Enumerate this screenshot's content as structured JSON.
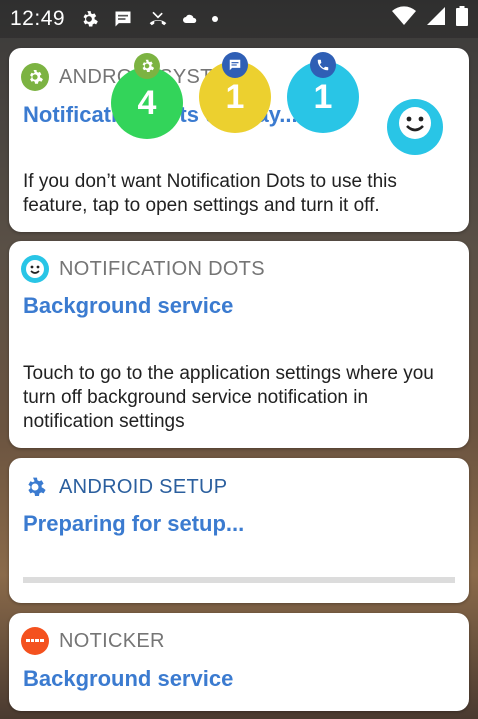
{
  "status_bar": {
    "time": "12:49",
    "icons_left": [
      "gear-icon",
      "message-icon",
      "missed-call-icon",
      "cloud-icon",
      "dot-icon"
    ],
    "icons_right": [
      "wifi-icon",
      "signal-icon",
      "battery-icon"
    ]
  },
  "notifications": [
    {
      "app_name": "ANDROID SYST",
      "app_icon": "gear-icon",
      "title": "Notification Dots display...",
      "body": "If you don’t want Notification Dots to use this feature, tap to open settings and turn it off.",
      "icon_color": "#7cb342"
    },
    {
      "app_name": "NOTIFICATION DOTS",
      "app_icon": "smiley-icon",
      "title": "Background service",
      "body": "Touch to go to the application settings where you turn off background service notification in notification settings",
      "icon_color": "#29c5e6"
    },
    {
      "app_name": "ANDROID SETUP",
      "app_icon": "gear-icon",
      "title": "Preparing for setup...",
      "icon_color": "#3b7bd0",
      "progress": 0
    },
    {
      "app_name": "NOTICKER",
      "app_icon": "ticker-icon",
      "title": "Background service",
      "icon_color": "#f4511e"
    }
  ],
  "overlay_badges": [
    {
      "count": "4",
      "color": "#33d45a",
      "icon": "gear-icon"
    },
    {
      "count": "1",
      "color": "#ecd02f",
      "icon": "message-icon"
    },
    {
      "count": "1",
      "color": "#29c5e6",
      "icon": "phone-icon"
    }
  ],
  "floating_button": {
    "icon": "smiley-icon",
    "color": "#29c5e6"
  }
}
